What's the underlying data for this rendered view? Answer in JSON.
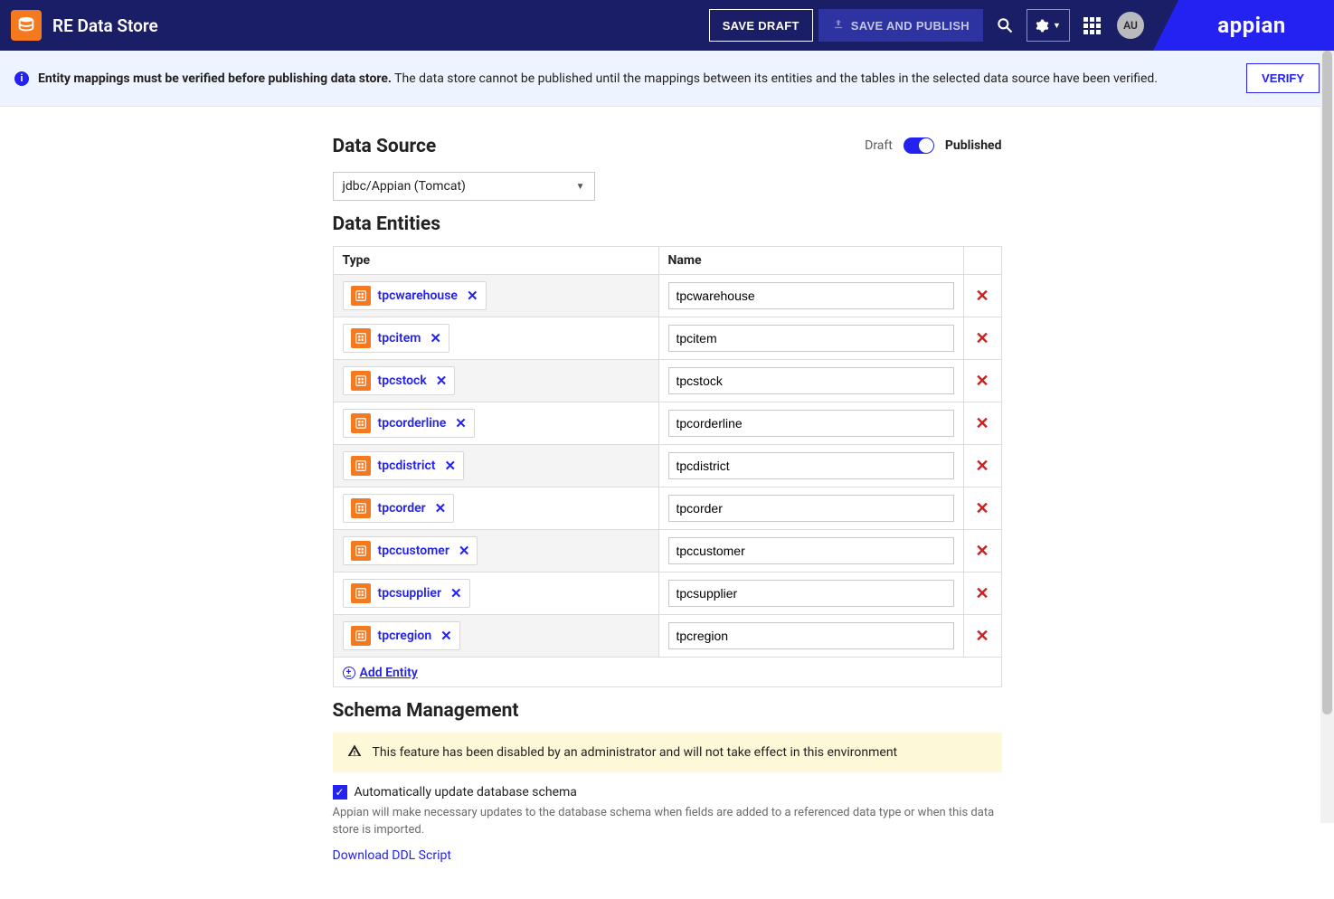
{
  "header": {
    "title": "RE Data Store",
    "save_draft_label": "SAVE DRAFT",
    "save_publish_label": "SAVE AND PUBLISH",
    "avatar_initials": "AU",
    "brand": "appian"
  },
  "banner": {
    "bold": "Entity mappings must be verified before publishing data store.",
    "rest": "The data store cannot be published until the mappings between its entities and the tables in the selected data source have been verified.",
    "verify_label": "VERIFY"
  },
  "toggle": {
    "left": "Draft",
    "right": "Published"
  },
  "sections": {
    "data_source": "Data Source",
    "data_entities": "Data Entities",
    "schema": "Schema Management"
  },
  "data_source": {
    "selected": "jdbc/Appian (Tomcat)"
  },
  "table": {
    "headers": {
      "type": "Type",
      "name": "Name"
    },
    "rows": [
      {
        "type": "tpcwarehouse",
        "name": "tpcwarehouse"
      },
      {
        "type": "tpcitem",
        "name": "tpcitem"
      },
      {
        "type": "tpcstock",
        "name": "tpcstock"
      },
      {
        "type": "tpcorderline",
        "name": "tpcorderline"
      },
      {
        "type": "tpcdistrict",
        "name": "tpcdistrict"
      },
      {
        "type": "tpcorder",
        "name": "tpcorder"
      },
      {
        "type": "tpccustomer",
        "name": "tpccustomer"
      },
      {
        "type": "tpcsupplier",
        "name": "tpcsupplier"
      },
      {
        "type": "tpcregion",
        "name": "tpcregion"
      }
    ],
    "add_label": "Add Entity"
  },
  "schema": {
    "warning": "This feature has been disabled by an administrator and will not take effect in this environment",
    "checkbox_label": "Automatically update database schema",
    "help": "Appian will make necessary updates to the database schema when fields are added to a referenced data type or when this data store is imported.",
    "download_label": "Download DDL Script"
  }
}
